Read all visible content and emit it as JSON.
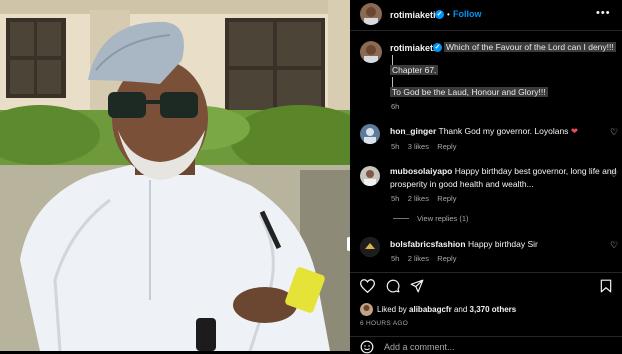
{
  "post": {
    "author": "rotimiaketi",
    "follow_label": "Follow",
    "separator": "•",
    "more_glyph": "•••",
    "caption_lines": [
      "Which of the Favour of the Lord can I deny!!!",
      "Chapter 67.",
      "To God be the Laud, Honour and Glory!!!"
    ],
    "caption_time": "6h",
    "verified_glyph": "✓"
  },
  "comments": [
    {
      "username": "hon_ginger",
      "text": "Thank God my governor. Loyolans",
      "emoji": "❤",
      "time": "5h",
      "likes": "3 likes",
      "reply": "Reply"
    },
    {
      "username": "mubosolaiyapo",
      "text_line1": "Happy birthday best governor, long life and",
      "text_line2": "prosperity in good health and wealth...",
      "time": "5h",
      "likes": "2 likes",
      "reply": "Reply",
      "view_replies": "View replies (1)"
    },
    {
      "username": "bolsfabricsfashion",
      "text": "Happy birthday Sir",
      "time": "5h",
      "likes": "2 likes",
      "reply": "Reply"
    }
  ],
  "engagement": {
    "liked_prefix": "Liked by",
    "liked_user": "alibabagcfr",
    "liked_and": "and",
    "liked_others": "3,370 others",
    "time_ago": "6 HOURS AGO"
  },
  "add_comment": {
    "placeholder": "Add a comment..."
  },
  "colors": {
    "background": "#000000",
    "accent": "#0095f6",
    "heart": "#ed4956",
    "muted": "#a8a8a8"
  },
  "icons": [
    "verified-icon",
    "more-options-icon",
    "like-icon",
    "comment-icon",
    "share-icon",
    "emoji-icon",
    "heart-small-icon"
  ]
}
